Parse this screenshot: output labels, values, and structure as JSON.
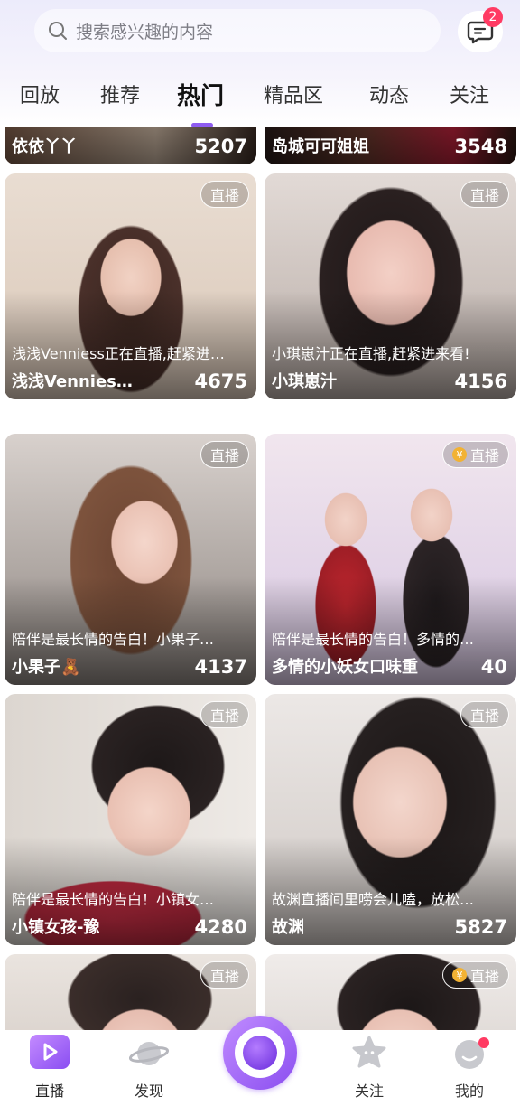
{
  "search": {
    "placeholder": "搜索感兴趣的内容"
  },
  "messages": {
    "badge": "2"
  },
  "tabs": [
    {
      "label": "回放"
    },
    {
      "label": "推荐"
    },
    {
      "label": "热门"
    },
    {
      "label": "精品区"
    },
    {
      "label": "动态"
    },
    {
      "label": "关注"
    }
  ],
  "active_tab": "热门",
  "top_partial_cards": [
    {
      "name": "依依丫丫",
      "count": "5207"
    },
    {
      "name": "岛城可可姐姐",
      "count": "3548"
    }
  ],
  "cards": [
    {
      "tag": "直播",
      "desc": "浅浅Venniess正在直播,赶紧进…",
      "name": "浅浅Vennies…",
      "count": "4675",
      "coin": false
    },
    {
      "tag": "直播",
      "desc": "小琪崽汁正在直播,赶紧进来看!",
      "name": "小琪崽汁",
      "count": "4156",
      "coin": false
    },
    {
      "tag": "直播",
      "desc": "陪伴是最长情的告白！小果子…",
      "name": "小果子🧸",
      "count": "4137",
      "coin": false
    },
    {
      "tag": "直播",
      "desc": "陪伴是最长情的告白！多情的…",
      "name": "多情的小妖女口味重",
      "count": "40",
      "coin": true
    },
    {
      "tag": "直播",
      "desc": "陪伴是最长情的告白！小镇女…",
      "name": "小镇女孩-豫",
      "count": "4280",
      "coin": false
    },
    {
      "tag": "直播",
      "desc": "故渊直播间里唠会儿嗑，放松…",
      "name": "故渊",
      "count": "5827",
      "coin": false
    }
  ],
  "bottom_partial_cards": [
    {
      "tag": "直播",
      "coin": false
    },
    {
      "tag": "直播",
      "coin": true
    }
  ],
  "coin_symbol": "¥",
  "bottom_nav": [
    {
      "label": "直播"
    },
    {
      "label": "发现"
    },
    {
      "label": "关注"
    },
    {
      "label": "我的"
    }
  ],
  "colors": {
    "accent": "#8e5cf0",
    "badge": "#ff3b63"
  }
}
